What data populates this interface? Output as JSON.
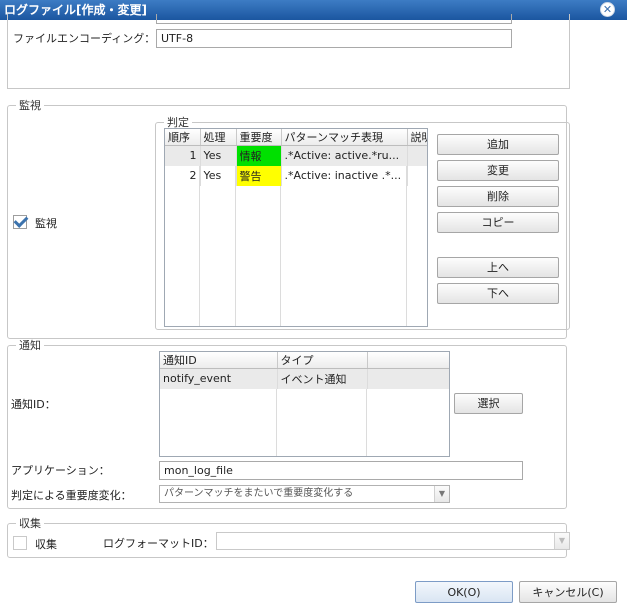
{
  "window": {
    "title": "ログファイル[作成・変更]",
    "close_icon": "close-icon"
  },
  "file_section": {
    "encoding_label": "ファイルエンコーディング：",
    "encoding_value": "UTF-8"
  },
  "monitor": {
    "legend": "監視",
    "checkbox_label": "監視",
    "checked": true,
    "judgement": {
      "legend": "判定",
      "columns": [
        "順序",
        "処理",
        "重要度",
        "パターンマッチ表現",
        "説明"
      ],
      "rows": [
        {
          "order": "1",
          "process": "Yes",
          "severity": "情報",
          "severity_color": "#00e000",
          "pattern": ".*Active: active.*ru...",
          "desc": ""
        },
        {
          "order": "2",
          "process": "Yes",
          "severity": "警告",
          "severity_color": "#ffff00",
          "pattern": ".*Active: inactive .*...",
          "desc": ""
        }
      ]
    },
    "buttons": {
      "add": "追加",
      "modify": "変更",
      "delete": "削除",
      "copy": "コピー",
      "up": "上へ",
      "down": "下へ"
    }
  },
  "notify": {
    "legend": "通知",
    "id_label": "通知ID：",
    "columns": [
      "通知ID",
      "タイプ"
    ],
    "rows": [
      {
        "id": "notify_event",
        "type": "イベント通知"
      }
    ],
    "select_button": "選択",
    "app_label": "アプリケーション：",
    "app_value": "mon_log_file",
    "severity_change_label": "判定による重要度変化：",
    "severity_change_value": "パターンマッチをまたいで重要度変化する"
  },
  "collect": {
    "legend": "収集",
    "checkbox_label": "収集",
    "checked": false,
    "format_label": "ログフォーマットID：",
    "format_value": ""
  },
  "footer": {
    "ok": "OK(O)",
    "cancel": "キャンセル(C)"
  }
}
